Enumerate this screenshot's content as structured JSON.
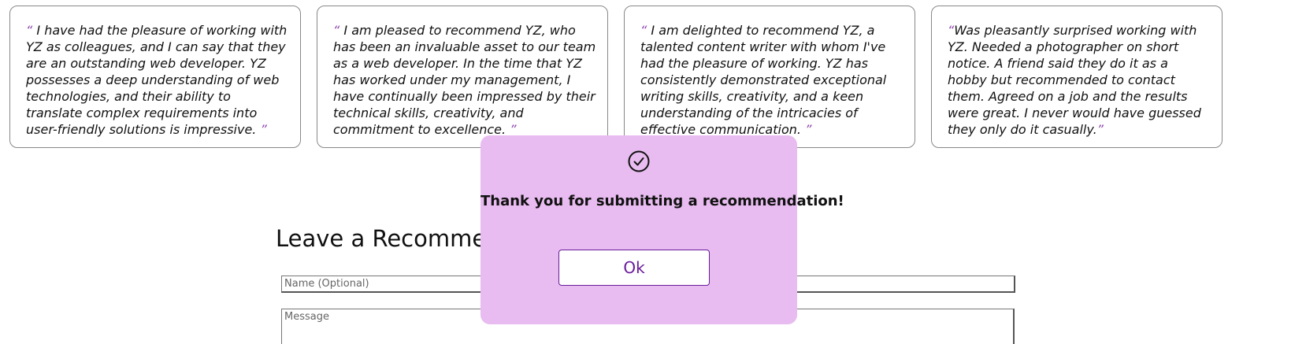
{
  "recommendations": [
    {
      "open_quote": "“",
      "text": " I have had the pleasure of working with YZ as colleagues, and I can say that they are an outstanding web developer. YZ possesses a deep understanding of web technologies, and their ability to translate complex requirements into user-friendly solutions is impressive. ",
      "close_quote": "”"
    },
    {
      "open_quote": "“",
      "text": " I am pleased to recommend YZ, who has been an invaluable asset to our team as a web developer. In the time that YZ has worked under my management, I have continually been impressed by their technical skills, creativity, and commitment to excellence. ",
      "close_quote": "”"
    },
    {
      "open_quote": "“",
      "text": " I am delighted to recommend YZ, a talented content writer with whom I've had the pleasure of working. YZ has consistently demonstrated exceptional writing skills, creativity, and a keen understanding of the intricacies of effective communication. ",
      "close_quote": "”"
    },
    {
      "open_quote": "“",
      "text": "Was pleasantly surprised working with YZ. Needed a photographer on short notice. A friend said they do it as a hobby but recommended to contact them. Agreed on a job and the results were great. I never would have guessed they only do it casually.",
      "close_quote": "”"
    }
  ],
  "form": {
    "title": "Leave a Recommendation",
    "name_placeholder": "Name (Optional)",
    "message_placeholder": "Message"
  },
  "modal": {
    "icon": "check-circle-icon",
    "message": "Thank you for submitting a recommendation!",
    "ok_label": "Ok"
  },
  "colors": {
    "accent": "#6a1b9a",
    "quote": "#8e44ad",
    "modal_background": "#e8bcf0"
  }
}
